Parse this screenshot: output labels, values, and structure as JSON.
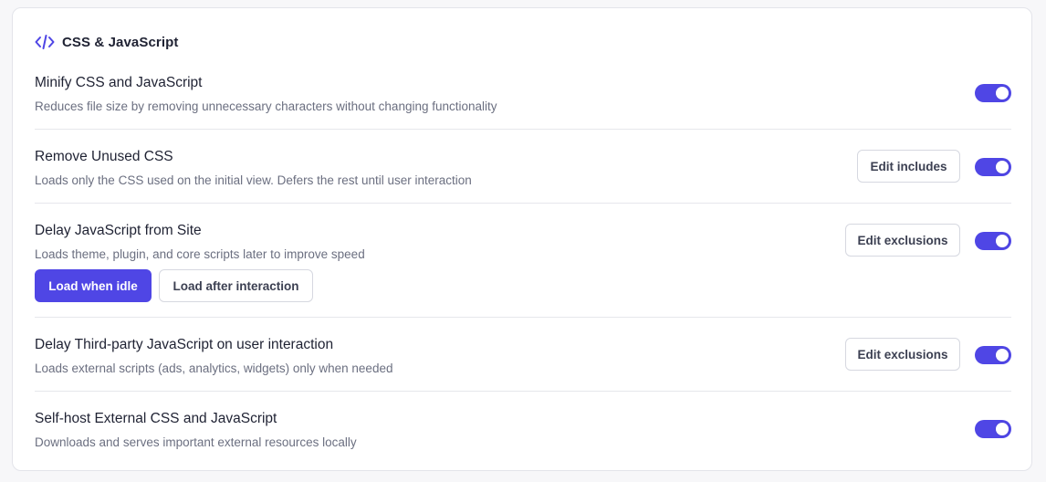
{
  "section": {
    "title": "CSS & JavaScript",
    "icon": "code-icon",
    "accent_color": "#4f46e5"
  },
  "settings": [
    {
      "title": "Minify CSS and JavaScript",
      "description": "Reduces file size by removing unnecessary characters without changing functionality",
      "enabled": true
    },
    {
      "title": "Remove Unused CSS",
      "description": "Loads only the CSS used on the initial view. Defers the rest until user interaction",
      "action_label": "Edit includes",
      "enabled": true
    },
    {
      "title": "Delay JavaScript from Site",
      "description": "Loads theme, plugin, and core scripts later to improve speed",
      "action_label": "Edit exclusions",
      "modes": [
        "Load when idle",
        "Load after interaction"
      ],
      "selected_mode": "Load when idle",
      "enabled": true
    },
    {
      "title": "Delay Third-party JavaScript on user interaction",
      "description": "Loads external scripts (ads, analytics, widgets) only when needed",
      "action_label": "Edit exclusions",
      "enabled": true
    },
    {
      "title": "Self-host External CSS and JavaScript",
      "description": "Downloads and serves important external resources locally",
      "enabled": true
    }
  ]
}
